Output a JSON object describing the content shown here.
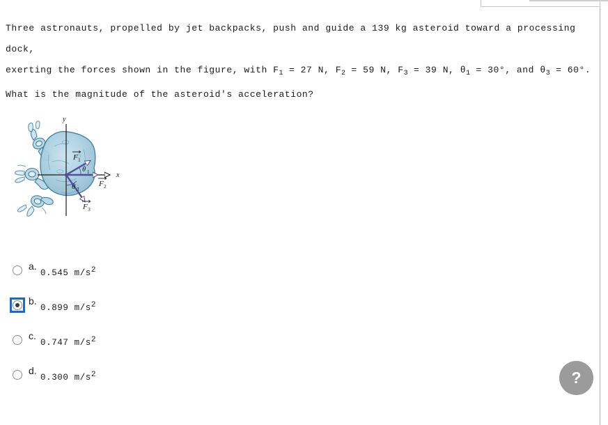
{
  "question": {
    "line1": "Three astronauts, propelled by jet backpacks, push and guide a 139 kg asteroid toward a processing dock,",
    "line2_pre": "exerting the forces shown in the figure, with F",
    "f1_sub": "1",
    "line2_a": " = 27 N, F",
    "f2_sub": "2",
    "line2_b": " = 59 N, F",
    "f3_sub": "3",
    "line2_c": " = 39 N, θ",
    "t1_sub": "1",
    "line2_d": " = 30°, and θ",
    "t3_sub": "3",
    "line2_e": " = 60°.",
    "line3": "What is the magnitude of the asteroid's acceleration?",
    "mass": "139 kg",
    "F1": "27 N",
    "F2": "59 N",
    "F3": "39 N",
    "theta1": "30°",
    "theta3": "60°"
  },
  "figure": {
    "axis_x_label": "x",
    "axis_y_label": "y",
    "vector_f1_label": "F",
    "vector_f1_sub": "1",
    "vector_f2_label": "F",
    "vector_f2_sub": "2",
    "vector_f3_label": "F",
    "vector_f3_sub": "3",
    "angle_theta1_label": "θ",
    "angle_theta1_sub": "1",
    "angle_theta3_label": "θ",
    "angle_theta3_sub": "3",
    "colors": {
      "vector": "#4f4f9c",
      "asteroid_fill": "#a9cbdd",
      "asteroid_outline": "#3f7f9e",
      "axis": "#1a1a1a"
    }
  },
  "options": [
    {
      "letter": "a.",
      "value": "0.545 m/s",
      "exp": "2",
      "selected": false
    },
    {
      "letter": "b.",
      "value": "0.899 m/s",
      "exp": "2",
      "selected": true
    },
    {
      "letter": "c.",
      "value": "0.747 m/s",
      "exp": "2",
      "selected": false
    },
    {
      "letter": "d.",
      "value": "0.300 m/s",
      "exp": "2",
      "selected": false
    }
  ],
  "help": {
    "label": "?"
  },
  "theme": {
    "focus_ring": "#1769d4",
    "fab_bg": "#9b9b9b"
  }
}
